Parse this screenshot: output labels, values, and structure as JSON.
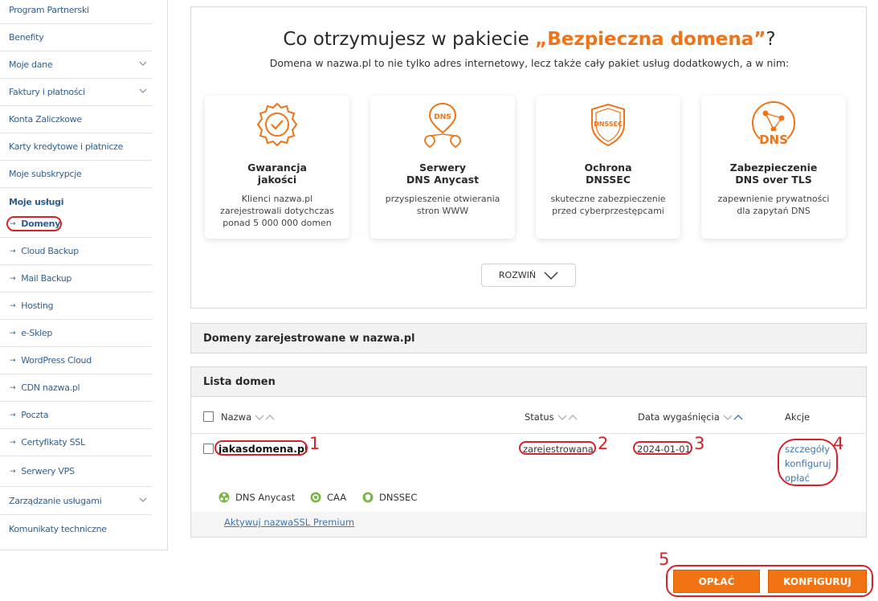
{
  "sidebar": {
    "items": [
      {
        "label": "Program Partnerski"
      },
      {
        "label": "Benefity"
      },
      {
        "label": "Moje dane"
      },
      {
        "label": "Faktury i płatności"
      },
      {
        "label": "Konta Zaliczkowe"
      },
      {
        "label": "Karty kredytowe i płatnicze"
      },
      {
        "label": "Moje subskrypcje"
      }
    ],
    "services_heading": "Moje usługi",
    "services": [
      {
        "label": "Domeny"
      },
      {
        "label": "Cloud Backup"
      },
      {
        "label": "Mail Backup"
      },
      {
        "label": "Hosting"
      },
      {
        "label": "e-Sklep"
      },
      {
        "label": "WordPress Cloud"
      },
      {
        "label": "CDN nazwa.pl"
      },
      {
        "label": "Poczta"
      },
      {
        "label": "Certyfikaty SSL"
      },
      {
        "label": "Serwery VPS"
      }
    ],
    "bottom_items": [
      {
        "label": "Zarządzanie usługami"
      },
      {
        "label": "Komunikaty techniczne"
      }
    ]
  },
  "package": {
    "title_prefix": "Co otrzymujesz w pakiecie ",
    "title_highlight": "„Bezpieczna domena”",
    "title_suffix": "?",
    "subtitle": "Domena w nazwa.pl to nie tylko adres internetowy, lecz także cały pakiet usług dodatkowych, a w nim:",
    "features": [
      {
        "title1": "Gwarancja",
        "title2": "jakości",
        "desc1": "Klienci nazwa.pl",
        "desc2": "zarejestrowali dotychczas",
        "desc3": "ponad 5 000 000 domen",
        "icon": "quality-badge-icon"
      },
      {
        "title1": "Serwery",
        "title2": "DNS Anycast",
        "desc1": "przyspieszenie otwierania",
        "desc2": "stron WWW",
        "desc3": "",
        "icon_text": "DNS",
        "icon": "dns-anycast-icon"
      },
      {
        "title1": "Ochrona",
        "title2": "DNSSEC",
        "desc1": "skuteczne zabezpieczenie",
        "desc2": "przed cyberprzestępcami",
        "desc3": "",
        "icon_text": "DNSSEC",
        "icon": "dnssec-shield-icon"
      },
      {
        "title1": "Zabezpieczenie",
        "title2": "DNS over TLS",
        "desc1": "zapewnienie prywatności",
        "desc2": "dla zapytań DNS",
        "desc3": "",
        "icon_text": "DNS",
        "icon": "dns-over-tls-icon"
      }
    ],
    "expand_label": "ROZWIŃ"
  },
  "registered_header": "Domeny zarejestrowane w nazwa.pl",
  "list": {
    "header": "Lista domen",
    "columns": {
      "name": "Nazwa",
      "status": "Status",
      "expiry": "Data wygaśnięcia",
      "actions": "Akcje"
    },
    "row": {
      "domain": "jakasdomena.pl",
      "status": "zarejestrowana",
      "expiry": "2024-01-01",
      "actions": [
        "szczegóły",
        "konfiguruj",
        "opłać"
      ],
      "services": [
        "DNS Anycast",
        "CAA",
        "DNSSEC"
      ],
      "ssl_link": "Aktywuj nazwaSSL Premium"
    }
  },
  "annotations": [
    "1",
    "2",
    "3",
    "4",
    "5"
  ],
  "buttons": {
    "pay": "OPŁAĆ",
    "configure": "KONFIGURUJ"
  },
  "colors": {
    "accent": "#f07317",
    "link": "#3b78b5",
    "annotation": "#d8222a",
    "service_ok": "#7ab648"
  }
}
